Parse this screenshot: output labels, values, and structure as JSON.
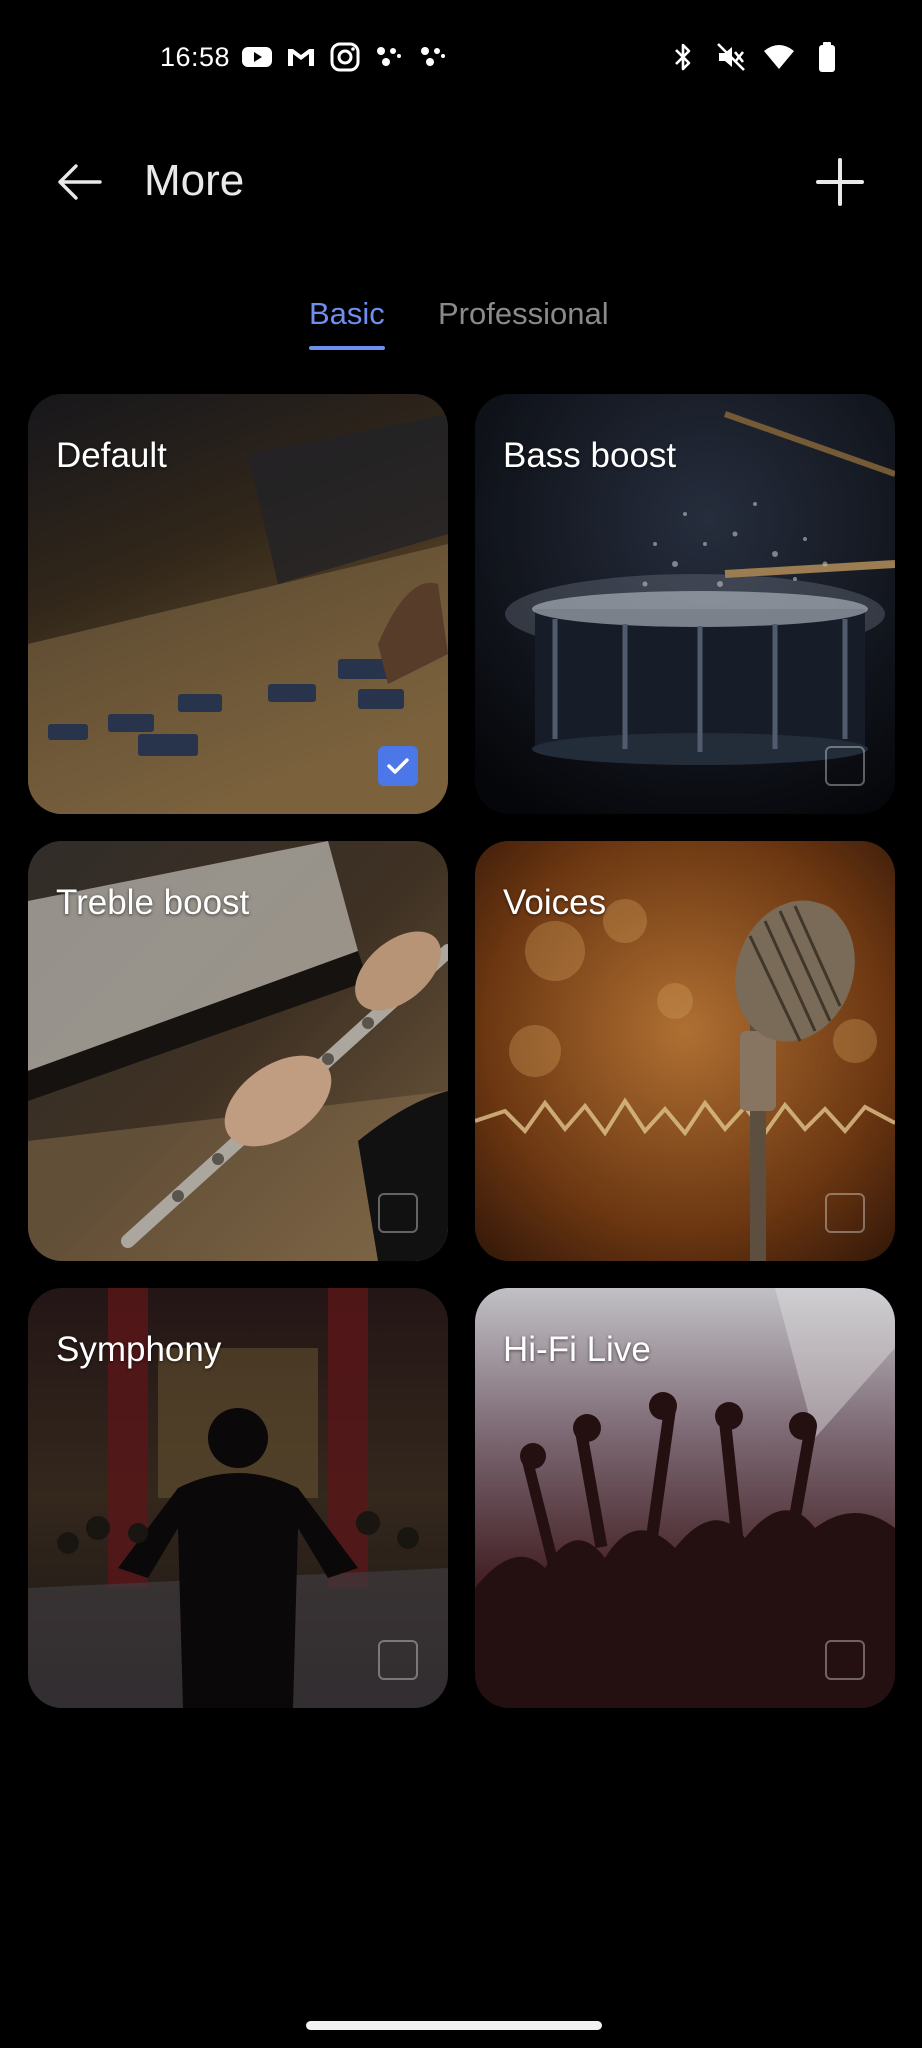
{
  "status_bar": {
    "time": "16:58",
    "left_icons": [
      "youtube-icon",
      "gmail-icon",
      "instagram-icon",
      "assistant-dots-icon",
      "assistant-dots-icon"
    ],
    "right_icons": [
      "bluetooth-icon",
      "mute-icon",
      "wifi-icon",
      "battery-icon"
    ]
  },
  "app_bar": {
    "title": "More",
    "back_icon": "arrow-left-icon",
    "add_icon": "plus-icon"
  },
  "tabs": [
    {
      "label": "Basic",
      "selected": true
    },
    {
      "label": "Professional",
      "selected": false
    }
  ],
  "presets": [
    {
      "label": "Default",
      "selected": true
    },
    {
      "label": "Bass boost",
      "selected": false
    },
    {
      "label": "Treble boost",
      "selected": false
    },
    {
      "label": "Voices",
      "selected": false
    },
    {
      "label": "Symphony",
      "selected": false
    },
    {
      "label": "Hi-Fi Live",
      "selected": false
    }
  ],
  "colors": {
    "background": "#000000",
    "accent": "#6e8ef0",
    "checkbox_selected": "#4c77e8",
    "tab_inactive": "#8a8a8a"
  }
}
